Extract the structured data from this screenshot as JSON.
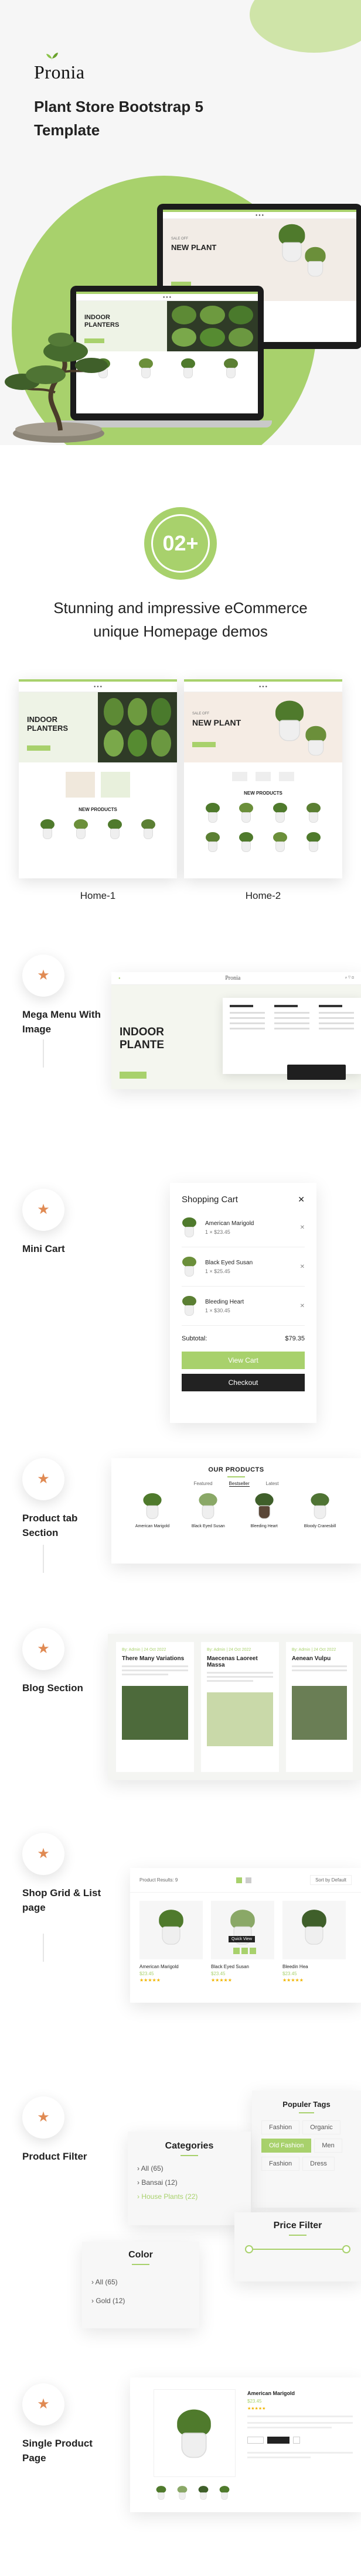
{
  "brand": {
    "name": "Pronia",
    "tagline": "Plant Store Bootstrap 5 Template"
  },
  "hero_screens": {
    "back": {
      "heading_line1": "NEW PLANT",
      "small": "SALE OFF"
    },
    "front": {
      "heading_line1": "INDOOR",
      "heading_line2": "PLANTERS"
    }
  },
  "demos": {
    "count": "02+",
    "title": "Stunning and impressive eCommerce unique Homepage demos",
    "items": [
      {
        "label": "Home-1",
        "heading_line1": "INDOOR",
        "heading_line2": "PLANTERS",
        "section": "NEW PRODUCTS"
      },
      {
        "label": "Home-2",
        "heading_line1": "NEW PLANT",
        "small": "SALE OFF",
        "section": "NEW PRODUCTS"
      }
    ]
  },
  "features": [
    {
      "title": "Mega Menu With Image",
      "icon": "star-icon"
    },
    {
      "title": "Mini Cart",
      "icon": "star-icon"
    },
    {
      "title": "Product tab Section",
      "icon": "star-icon"
    },
    {
      "title": "Blog Section",
      "icon": "star-icon"
    },
    {
      "title": "Shop Grid & List page",
      "icon": "star-icon"
    },
    {
      "title": "Product Filter",
      "icon": "star-icon"
    },
    {
      "title": "Single Product Page",
      "icon": "star-icon"
    }
  ],
  "mega_menu": {
    "heading_line1": "INDOOR",
    "heading_line2": "PLANTE"
  },
  "mini_cart": {
    "title": "Shopping Cart",
    "items": [
      {
        "name": "American Marigold",
        "price": "1 × $23.45"
      },
      {
        "name": "Black Eyed Susan",
        "price": "1 × $25.45"
      },
      {
        "name": "Bleeding Heart",
        "price": "1 × $30.45"
      }
    ],
    "subtotal_label": "Subtotal:",
    "subtotal_value": "$79.35",
    "view_cart": "View Cart",
    "checkout": "Checkout"
  },
  "product_tab": {
    "title": "OUR PRODUCTS",
    "tabs": [
      "Featured",
      "Bestseller",
      "Latest"
    ],
    "products": [
      "American Marigold",
      "Black Eyed Susan",
      "Bleeding Heart",
      "Bloody Cranesbill"
    ]
  },
  "blog": {
    "posts": [
      {
        "meta": "By: Admin  |  24 Oct 2022",
        "title": "There Many Variations"
      },
      {
        "meta": "By: Admin  |  24 Oct 2022",
        "title": "Maecenas Laoreet Massa"
      },
      {
        "meta": "By: Admin  |  24 Oct 2022",
        "title": "Aenean Vulpu"
      }
    ]
  },
  "shop_grid": {
    "result": "Product Results: 9",
    "sort": "Sort by Default",
    "products": [
      {
        "name": "American Marigold",
        "price": "$23.45"
      },
      {
        "name": "Black Eyed Susan",
        "price": "$23.45"
      },
      {
        "name": "Bleedin Hea",
        "price": "$23.45"
      }
    ],
    "badge": "Quick View"
  },
  "filter": {
    "categories_title": "Categories",
    "categories": [
      "All (65)",
      "Bansai (12)",
      "House Plants (22)"
    ],
    "color_title": "Color",
    "colors": [
      "All (65)",
      "Gold (12)"
    ],
    "tags_title": "Populer Tags",
    "tags": [
      "Fashion",
      "Organic",
      "Old Fashion",
      "Men",
      "Fashion",
      "Dress"
    ],
    "price_title": "Price Filter"
  },
  "single_product": {
    "name": "American Marigold",
    "price": "$23.45"
  }
}
